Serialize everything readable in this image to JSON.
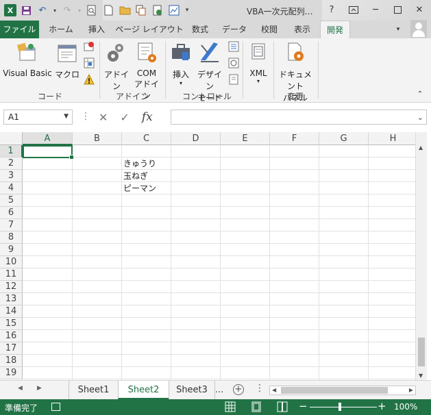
{
  "window": {
    "title": "VBA一次元配列…",
    "help": "?",
    "minimize": "─",
    "close": "✕"
  },
  "tabs": {
    "file": "ファイル",
    "home": "ホーム",
    "insert": "挿入",
    "page_layout": "ページ レイアウト",
    "formulas": "数式",
    "data": "データ",
    "review": "校閲",
    "view": "表示",
    "developer": "開発"
  },
  "ribbon": {
    "visual_basic": "Visual Basic",
    "macros": "マクロ",
    "addins": "アドイン",
    "com_addins_1": "COM",
    "com_addins_2": "アドイン",
    "insert": "挿入",
    "design_mode_1": "デザイン",
    "design_mode_2": "モード",
    "xml": "XML",
    "doc_panel_1": "ドキュメント",
    "doc_panel_2": "パネル",
    "group_code": "コード",
    "group_addins": "アドイン",
    "group_controls": "コントロール",
    "group_modify": "変更"
  },
  "formula_bar": {
    "name_box": "A1",
    "fx": "fx",
    "value": ""
  },
  "grid": {
    "columns": [
      "A",
      "B",
      "C",
      "D",
      "E",
      "F",
      "G",
      "H"
    ],
    "rows": [
      "1",
      "2",
      "3",
      "4",
      "5",
      "6",
      "7",
      "8",
      "9",
      "10",
      "11",
      "12",
      "13",
      "14",
      "15",
      "16",
      "17",
      "18",
      "19"
    ],
    "cells": {
      "C2": "きゅうり",
      "C3": "玉ねぎ",
      "C4": "ピーマン"
    },
    "active_cell": "A1"
  },
  "sheets": {
    "tabs": [
      "Sheet1",
      "Sheet2",
      "Sheet3"
    ],
    "active": "Sheet2",
    "more": "...",
    "more_menu": "⋮",
    "add": "+"
  },
  "status": {
    "ready": "準備完了",
    "zoom": "100%",
    "zoom_minus": "−",
    "zoom_plus": "+"
  },
  "colors": {
    "accent": "#217346",
    "chrome": "#d9d9d9",
    "ribbon_bg": "#f3f3f3"
  }
}
